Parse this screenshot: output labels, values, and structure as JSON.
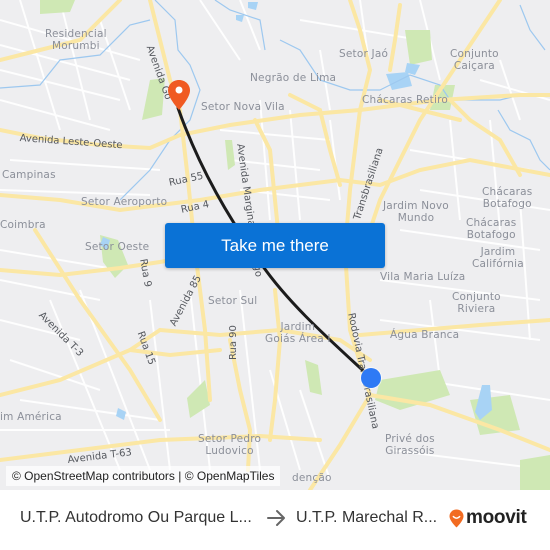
{
  "map": {
    "neighborhoods": [
      {
        "name": "Residencial Morumbi",
        "lines": [
          "Residencial",
          "Morumbi"
        ]
      },
      {
        "name": "Setor Jaó",
        "lines": [
          "Setor Jaó"
        ]
      },
      {
        "name": "Conjunto Caiçara",
        "lines": [
          "Conjunto",
          "Caiçara"
        ]
      },
      {
        "name": "Negrão de Lima",
        "lines": [
          "Negrão de Lima"
        ]
      },
      {
        "name": "Setor Nova Vila",
        "lines": [
          "Setor Nova Vila"
        ]
      },
      {
        "name": "Chácaras Retiro",
        "lines": [
          "Chácaras Retiro"
        ]
      },
      {
        "name": "Campinas",
        "lines": [
          "Campinas"
        ]
      },
      {
        "name": "Setor Aeroporto",
        "lines": [
          "Setor Aeroporto"
        ]
      },
      {
        "name": "Chácaras Botafogo",
        "lines": [
          "Chácaras",
          "Botafogo"
        ]
      },
      {
        "name": "Jardim Novo Mundo",
        "lines": [
          "Jardim Novo",
          "Mundo"
        ]
      },
      {
        "name": "Chácaras Botafogo 2",
        "lines": [
          "Chácaras",
          "Botafogo"
        ]
      },
      {
        "name": "Coimbra",
        "lines": [
          "Coimbra"
        ]
      },
      {
        "name": "Jardim Califórnia",
        "lines": [
          "Jardim",
          "Califórnia"
        ]
      },
      {
        "name": "Setor Oeste",
        "lines": [
          "Setor Oeste"
        ]
      },
      {
        "name": "Vila Maria Luíza",
        "lines": [
          "Vila Maria Luíza"
        ]
      },
      {
        "name": "Setor Sul",
        "lines": [
          "Setor Sul"
        ]
      },
      {
        "name": "Conjunto Riviera",
        "lines": [
          "Conjunto",
          "Riviera"
        ]
      },
      {
        "name": "Jardim Goiás Área I",
        "lines": [
          "Jardim",
          "Goiás Área I"
        ]
      },
      {
        "name": "Água Branca",
        "lines": [
          "Água Branca"
        ]
      },
      {
        "name": "Jardim América",
        "lines": [
          "im América"
        ]
      },
      {
        "name": "Setor Pedro Ludovico",
        "lines": [
          "Setor Pedro",
          "Ludovico"
        ]
      },
      {
        "name": "Privé dos Girassóis",
        "lines": [
          "Privé dos",
          "Girassóis"
        ]
      },
      {
        "name": "Redenção",
        "lines": [
          "denção"
        ]
      }
    ],
    "roads": [
      "Avenida Goiás",
      "Avenida Leste-Oeste",
      "Rua 55",
      "Rua 4",
      "Avenida Marginal Botafogo",
      "Rodovia Transbrasiliana",
      "Rua 9",
      "Avenida 85",
      "Avenida T-3",
      "Rua 15",
      "Rua 90",
      "Avenida T-63"
    ],
    "road_label_text": {
      "avenida_goias": "Avenida Go",
      "leste_oeste": "Avenida Leste-Oeste",
      "rua55": "Rua 55",
      "rua4": "Rua 4",
      "marginal": "Avenida Marginal Botafogo",
      "transbrasiliana_top": "Transbrasiliana",
      "transbrasiliana_bottom": "Rodovia Transbrasiliana",
      "rua9": "Rua 9",
      "av85": "Avenida 85",
      "avt3": "Avenida T-3",
      "rua15": "Rua 15",
      "rua90": "Rua 90",
      "avt63": "Avenida T-63"
    },
    "origin_marker": {
      "type": "destination-pin",
      "color": "#f05a22"
    },
    "current_marker": {
      "type": "origin-dot",
      "color": "#2e7af5"
    },
    "route_color": "#1c1c1c",
    "colors": {
      "background": "#eeeef0",
      "major_road": "#fbe7a4",
      "minor_road": "#ffffff",
      "park": "#cfe8b4",
      "water": "#a8d3f5"
    }
  },
  "cta": {
    "label": "Take me there",
    "color": "#0a72d6"
  },
  "attribution": "© OpenStreetMap contributors | © OpenMapTiles",
  "trip": {
    "from": "U.T.P. Autodromo Ou Parque L...",
    "to": "U.T.P. Marechal R...",
    "arrow_icon": "right-arrow"
  },
  "brand": {
    "name": "moovit",
    "color": "#f26b21"
  }
}
